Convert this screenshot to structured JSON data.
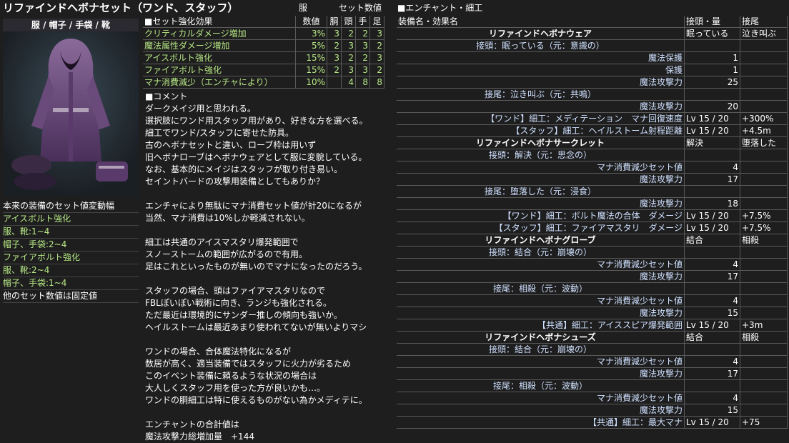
{
  "title": "リファインドヘボナセット（ワンド、スタッフ）",
  "headers": {
    "slot": "服",
    "set_values": "セット数値",
    "enchant": "■エンチャント・細工"
  },
  "image_label": "服 / 帽子 / 手袋 / 靴",
  "set_effects": {
    "header": "■セット強化効果",
    "col_value": "数値",
    "col_body": "胴",
    "col_head": "頭",
    "col_hands": "手",
    "col_feet": "足",
    "rows": [
      {
        "name": "クリティカルダメージ増加",
        "value": "3%",
        "a": "3",
        "b": "2",
        "c": "2",
        "d": "3"
      },
      {
        "name": "魔法属性ダメージ増加",
        "value": "5%",
        "a": "2",
        "b": "3",
        "c": "3",
        "d": "2"
      },
      {
        "name": "アイスボルト強化",
        "value": "15%",
        "a": "3",
        "b": "2",
        "c": "2",
        "d": "3"
      },
      {
        "name": "ファイアボルト強化",
        "value": "15%",
        "a": "2",
        "b": "3",
        "c": "3",
        "d": "2"
      },
      {
        "name": "マナ消費減少（エンチャにより）",
        "value": "10%",
        "a": "",
        "b": "4",
        "c": "8",
        "d": "8"
      }
    ]
  },
  "comment_header": "■コメント",
  "comment_lines": [
    "ダークメイジ用と思われる。",
    "選択肢にワンド用スタッフ用があり、好きな方を選べる。",
    "細工でワンド/スタッフに寄せた防具。",
    "古のヘボナセットと違い、ローブ枠は用いず",
    "旧ヘボナローブはヘボナウェアとして服に変貌している。",
    "なお、基本的にメイジはスタッフが取り付き易い。",
    "セイントバードの攻撃用装備としてもありか？",
    "",
    "エンチャにより無駄にマナ消費セット値が計20になるが",
    "当然、マナ消費は10%しか軽減されない。",
    "",
    "細工は共通のアイスマスタリ爆発範囲で",
    "スノーストームの範囲が広がるので有用。",
    "足はこれといったものが無いのでマナになったのだろう。",
    "",
    "スタッフの場合、頭はファイアマスタリなので",
    "FBLぽいぽい戦術に向き、ランジも強化される。",
    "ただ最近は環境的にサンダー推しの傾向も強いか。",
    "ヘイルストームは最近あまり使われてないが無いよりマシ",
    "",
    "ワンドの場合、合体魔法特化になるが",
    "数居が高く、適当装備ではスタッフに火力が劣るため",
    "このイベント装備に頼るような状況の場合は",
    "大人しくスタッフ用を使った方が良いかも…。",
    "ワンドの胴細工は特に使えるものがない為かメディテに。",
    "",
    "エンチャントの合計値は",
    "魔法攻撃力総増加量　+144"
  ],
  "left_notes": [
    {
      "text": "本来の装備のセット値変動幅",
      "green": false
    },
    {
      "text": "アイスボルト強化",
      "green": true
    },
    {
      "text": "服、靴:1~4",
      "green": true
    },
    {
      "text": "帽子、手袋:2~4",
      "green": true
    },
    {
      "text": "ファイアボルト強化",
      "green": true
    },
    {
      "text": "服、靴:2~4",
      "green": true
    },
    {
      "text": "帽子、手袋:1~4",
      "green": true
    },
    {
      "text": "他のセット数値は固定値",
      "green": false
    }
  ],
  "enchant": {
    "col_name": "装備名・効果名",
    "col_qty": "接頭・量",
    "col_suffix": "接尾",
    "rows": [
      {
        "t": "item",
        "name": "リファインドヘボナウェア",
        "q": "眠っている",
        "s": "泣き叫ぶ"
      },
      {
        "t": "pre",
        "name": "接頭：眠っている（元：意識の）",
        "q": "",
        "s": ""
      },
      {
        "t": "eff",
        "name": "魔法保護",
        "q": "1",
        "s": ""
      },
      {
        "t": "eff",
        "name": "保護",
        "q": "1",
        "s": ""
      },
      {
        "t": "eff",
        "name": "魔法攻撃力",
        "q": "25",
        "s": ""
      },
      {
        "t": "pre",
        "name": "接尾：泣き叫ぶ（元：共鳴）",
        "q": "",
        "s": ""
      },
      {
        "t": "eff",
        "name": "魔法攻撃力",
        "q": "20",
        "s": ""
      },
      {
        "t": "craft",
        "name": "【ワンド】細工：メディテーション　マナ回復速度",
        "q": "Lv 15 / 20",
        "s": "+300%"
      },
      {
        "t": "craft",
        "name": "【スタッフ】細工：ヘイルストーム射程距離",
        "q": "Lv 15 / 20",
        "s": "+4.5m"
      },
      {
        "t": "item",
        "name": "リファインドヘボナサークレット",
        "q": "解決",
        "s": "堕落した"
      },
      {
        "t": "pre",
        "name": "接頭：解決（元：思念の）",
        "q": "",
        "s": ""
      },
      {
        "t": "eff",
        "name": "マナ消費減少セット値",
        "q": "4",
        "s": ""
      },
      {
        "t": "eff",
        "name": "魔法攻撃力",
        "q": "17",
        "s": ""
      },
      {
        "t": "pre",
        "name": "接尾：堕落した（元：浸食）",
        "q": "",
        "s": ""
      },
      {
        "t": "eff",
        "name": "魔法攻撃力",
        "q": "18",
        "s": ""
      },
      {
        "t": "craft",
        "name": "【ワンド】細工：ボルト魔法の合体　ダメージ",
        "q": "Lv 15 / 20",
        "s": "+7.5%"
      },
      {
        "t": "craft",
        "name": "【スタッフ】細工：ファイアマスタリ　ダメージ",
        "q": "Lv 15 / 20",
        "s": "+7.5%"
      },
      {
        "t": "item",
        "name": "リファインドヘボナグローブ",
        "q": "結合",
        "s": "相殺"
      },
      {
        "t": "pre",
        "name": "接頭：結合（元：崩壊の）",
        "q": "",
        "s": ""
      },
      {
        "t": "eff",
        "name": "マナ消費減少セット値",
        "q": "4",
        "s": ""
      },
      {
        "t": "eff",
        "name": "魔法攻撃力",
        "q": "17",
        "s": ""
      },
      {
        "t": "pre",
        "name": "接尾：相殺（元：波動）",
        "q": "",
        "s": ""
      },
      {
        "t": "eff",
        "name": "マナ消費減少セット値",
        "q": "4",
        "s": ""
      },
      {
        "t": "eff",
        "name": "魔法攻撃力",
        "q": "15",
        "s": ""
      },
      {
        "t": "craft",
        "name": "【共通】細工：アイススピア爆発範囲",
        "q": "Lv 15 / 20",
        "s": "+3m"
      },
      {
        "t": "item",
        "name": "リファインドヘボナシューズ",
        "q": "結合",
        "s": "相殺"
      },
      {
        "t": "pre",
        "name": "接頭：結合（元：崩壊の）",
        "q": "",
        "s": ""
      },
      {
        "t": "eff",
        "name": "マナ消費減少セット値",
        "q": "4",
        "s": ""
      },
      {
        "t": "eff",
        "name": "魔法攻撃力",
        "q": "17",
        "s": ""
      },
      {
        "t": "pre",
        "name": "接尾：相殺（元：波動）",
        "q": "",
        "s": ""
      },
      {
        "t": "eff",
        "name": "マナ消費減少セット値",
        "q": "4",
        "s": ""
      },
      {
        "t": "eff",
        "name": "魔法攻撃力",
        "q": "15",
        "s": ""
      },
      {
        "t": "craft",
        "name": "【共通】細工：最大マナ",
        "q": "Lv 15 / 20",
        "s": "+75"
      }
    ]
  }
}
